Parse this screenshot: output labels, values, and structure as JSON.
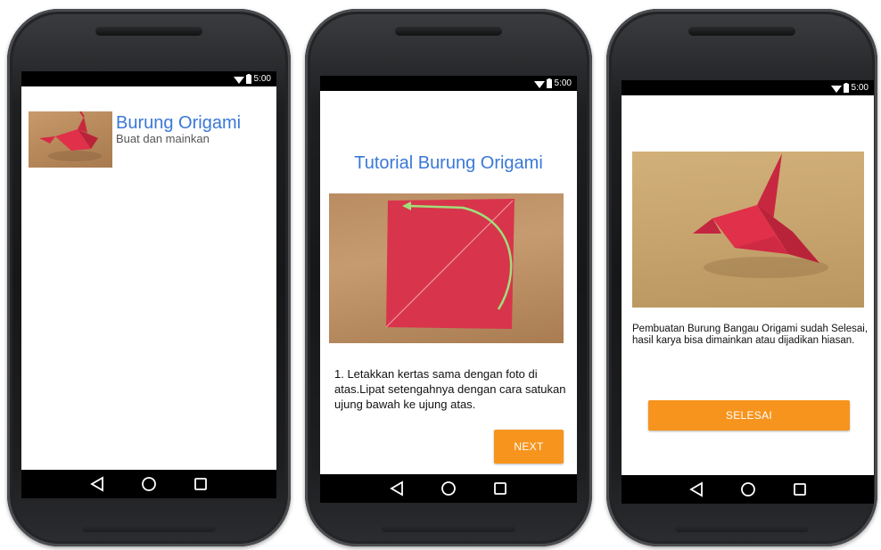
{
  "screen1": {
    "status_time": "5:00",
    "item": {
      "title": "Burung Origami",
      "subtitle": "Buat dan mainkan",
      "image_icon": "origami-crane-photo"
    }
  },
  "screen2": {
    "status_time": "5:00",
    "title": "Tutorial Burung Origami",
    "image_icon": "folding-step-photo",
    "instruction": "1. Letakkan kertas sama dengan foto di atas.Lipat setengahnya dengan cara satukan ujung bawah ke ujung atas.",
    "next_label": "NEXT"
  },
  "screen3": {
    "status_time": "5:00",
    "image_icon": "finished-crane-photo",
    "message": "Pembuatan Burung Bangau Origami sudah Selesai, hasil karya bisa dimainkan atau dijadikan hiasan.",
    "finish_label": "SELESAI"
  },
  "navbar": {
    "back_icon": "back-triangle-icon",
    "home_icon": "home-circle-icon",
    "recents_icon": "recents-square-icon"
  },
  "colors": {
    "title_blue": "#3a78d8",
    "button_orange": "#f7941d"
  }
}
